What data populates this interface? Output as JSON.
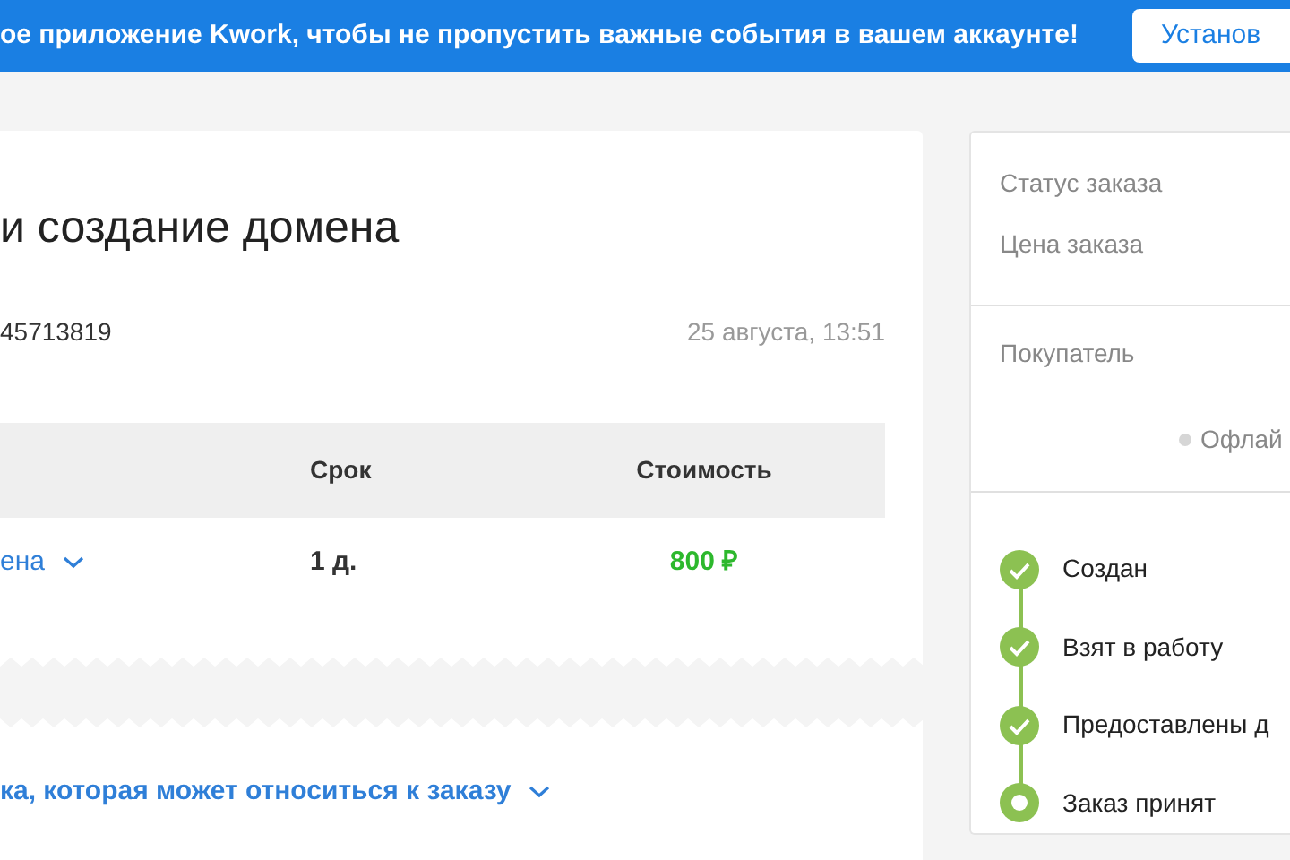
{
  "banner": {
    "text": "ое приложение Kwork, чтобы не пропустить важные события в вашем аккаунте!",
    "button": "Установ"
  },
  "order": {
    "title": "и создание домена",
    "number": "45713819",
    "date": "25 августа, 13:51",
    "table": {
      "columns": [
        "Срок",
        "Стоимость"
      ],
      "rows": [
        {
          "name": "ена",
          "term": "1 д.",
          "price": "800 ₽"
        }
      ]
    }
  },
  "related": {
    "link": "ка, которая может относиться к заказу"
  },
  "sidebar": {
    "status_label": "Статус заказа",
    "price_label": "Цена заказа",
    "buyer_label": "Покупатель",
    "buyer_status": {
      "text": "Офлай",
      "online": false
    },
    "steps": [
      {
        "label": "Создан",
        "done": true
      },
      {
        "label": "Взят в работу",
        "done": true
      },
      {
        "label": "Предоставлены д",
        "done": true
      },
      {
        "label": "Заказ принят",
        "done": false
      }
    ]
  }
}
